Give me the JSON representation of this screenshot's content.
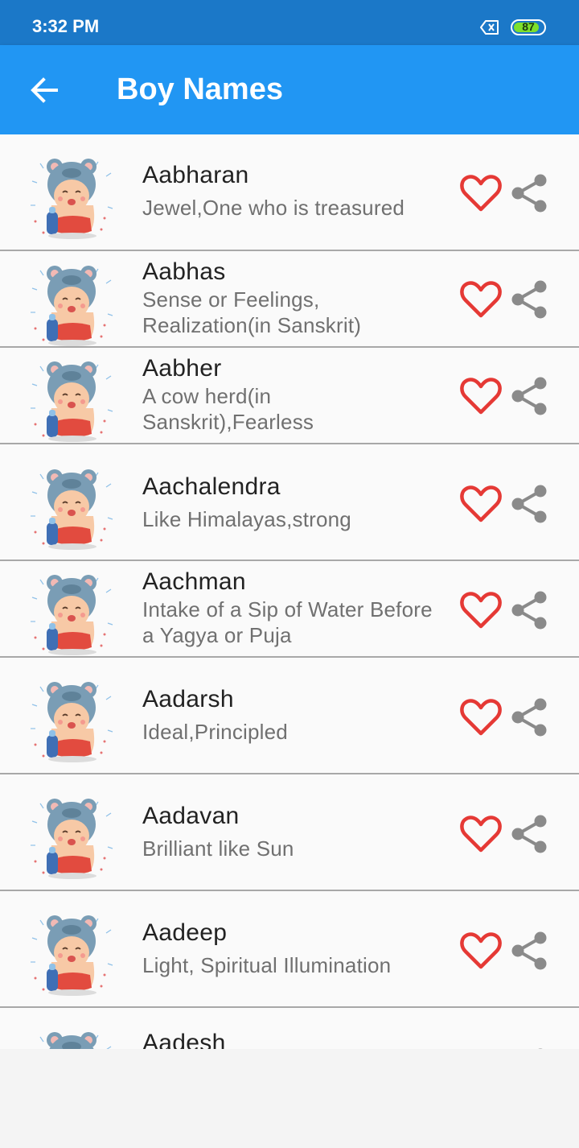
{
  "status_bar": {
    "time": "3:32 PM",
    "battery": "87",
    "battery_level": 0.87,
    "sim_icon": "sim-x-icon"
  },
  "app_bar": {
    "title": "Boy Names",
    "back_icon": "arrow-left-icon"
  },
  "colors": {
    "status_bar": "#1b78c8",
    "app_bar": "#2196f3",
    "heart": "#e53935",
    "share": "#8a8a8a",
    "battery": "#7ee02c"
  },
  "names": [
    {
      "name": "Aabharan",
      "meaning": "Jewel,One who is treasured"
    },
    {
      "name": "Aabhas",
      "meaning": "Sense or Feelings, Realization(in Sanskrit)"
    },
    {
      "name": "Aabher",
      "meaning": "A cow herd(in Sanskrit),Fearless"
    },
    {
      "name": "Aachalendra",
      "meaning": "Like Himalayas,strong"
    },
    {
      "name": "Aachman",
      "meaning": "Intake of a Sip of Water Before a Yagya or Puja"
    },
    {
      "name": "Aadarsh",
      "meaning": "Ideal,Principled"
    },
    {
      "name": "Aadavan",
      "meaning": "Brilliant like Sun"
    },
    {
      "name": "Aadeep",
      "meaning": "Light, Spiritual Illumination"
    },
    {
      "name": "Aadesh",
      "meaning": ""
    }
  ],
  "row_icons": {
    "avatar": "baby-avatar-icon",
    "favorite": "heart-outline-icon",
    "share": "share-icon"
  }
}
